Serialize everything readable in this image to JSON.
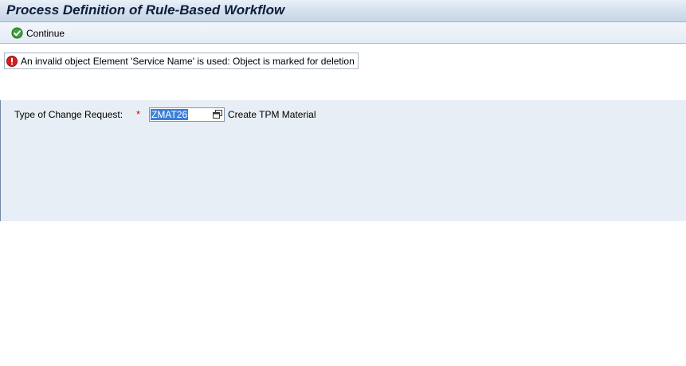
{
  "window": {
    "title": "Process Definition of Rule-Based Workflow"
  },
  "toolbar": {
    "continue_label": "Continue",
    "continue_icon": "checkmark-circle-icon"
  },
  "message": {
    "type": "error",
    "icon": "error-icon",
    "text": "An invalid object Element 'Service Name' is used: Object is marked for deletion"
  },
  "form": {
    "change_request_type": {
      "label": "Type of Change Request:",
      "required_marker": "*",
      "value": "ZMAT26",
      "description": "Create TPM Material",
      "value_help_icon": "value-help-icon"
    }
  },
  "colors": {
    "title_text": "#0b1e3a",
    "form_background": "#e8eef5",
    "selection": "#3c7fd9",
    "required": "#cc0000",
    "error_icon": "#d42020",
    "success_icon": "#2e9a2e"
  }
}
